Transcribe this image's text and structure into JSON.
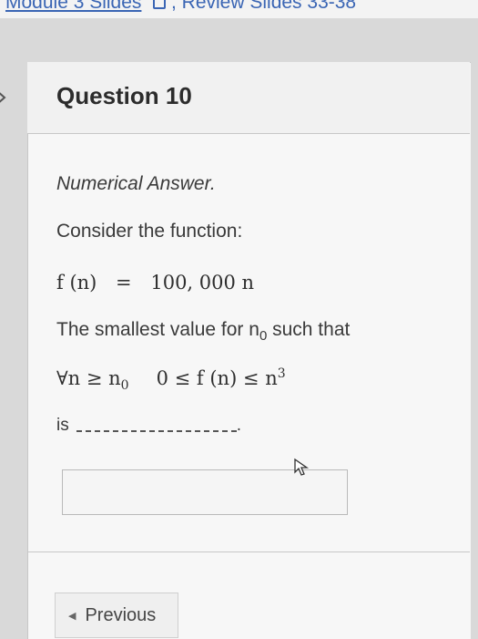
{
  "breadcrumb": {
    "link1": "Module 3 Slides",
    "link2": ", Review Slides 33-38"
  },
  "question": {
    "title": "Question 10",
    "type_label": "Numerical Answer.",
    "prompt": "Consider the function:",
    "function_lhs": "f (n)",
    "function_eq": "=",
    "function_rhs": "100, 000 n",
    "smallest_pre": "The smallest value for n",
    "smallest_sub": "0",
    "smallest_post": " such that",
    "forall_prefix": "∀n ≥ n",
    "forall_sub": "0",
    "inequality_pre": "0 ≤ f (n) ≤ n",
    "inequality_sup": "3",
    "is_label": "is",
    "is_suffix": "."
  },
  "answer": {
    "value": ""
  },
  "nav": {
    "previous_label": "Previous"
  }
}
